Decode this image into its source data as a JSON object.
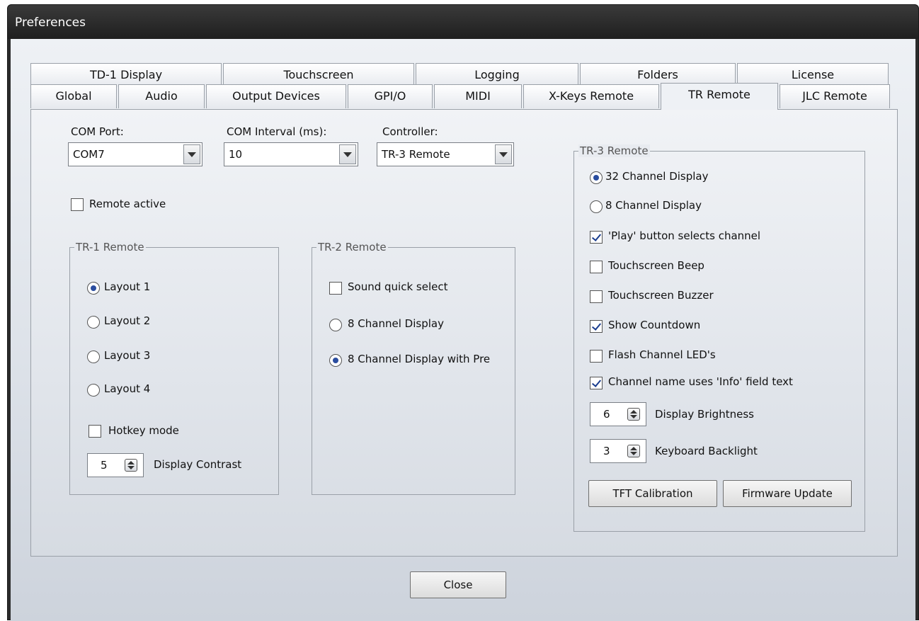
{
  "window": {
    "title": "Preferences"
  },
  "tabs": {
    "row1": [
      "TD-1 Display",
      "Touchscreen",
      "Logging",
      "Folders",
      "License"
    ],
    "row2": [
      "Global",
      "Audio",
      "Output Devices",
      "GPI/O",
      "MIDI",
      "X-Keys Remote",
      "TR Remote",
      "JLC Remote"
    ],
    "active": "TR Remote"
  },
  "com_port": {
    "label": "COM Port:",
    "value": "COM7"
  },
  "com_interval": {
    "label": "COM Interval (ms):",
    "value": "10"
  },
  "controller": {
    "label": "Controller:",
    "value": "TR-3 Remote"
  },
  "remote_active": {
    "label": "Remote active",
    "checked": false
  },
  "tr1": {
    "title": "TR-1 Remote",
    "layouts": [
      "Layout 1",
      "Layout 2",
      "Layout 3",
      "Layout 4"
    ],
    "selected_layout": "Layout 1",
    "hotkey_label": "Hotkey mode",
    "hotkey_checked": false,
    "contrast_value": "5",
    "contrast_label": "Display Contrast"
  },
  "tr2": {
    "title": "TR-2 Remote",
    "sound_quick_select": "Sound quick select",
    "sound_quick_select_checked": false,
    "option_8ch": "8 Channel Display",
    "option_8ch_pre": "8 Channel Display with Pre",
    "selected": "8 Channel Display with Pre"
  },
  "tr3": {
    "title": "TR-3 Remote",
    "radio_32": "32 Channel Display",
    "radio_8": "8 Channel Display",
    "selected": "32 Channel Display",
    "checks": [
      {
        "label": "'Play' button selects channel",
        "checked": true
      },
      {
        "label": "Touchscreen Beep",
        "checked": false
      },
      {
        "label": "Touchscreen Buzzer",
        "checked": false
      },
      {
        "label": "Show Countdown",
        "checked": true
      },
      {
        "label": "Flash Channel LED's",
        "checked": false
      },
      {
        "label": "Channel name uses 'Info' field text",
        "checked": true
      }
    ],
    "brightness_value": "6",
    "brightness_label": "Display Brightness",
    "backlight_value": "3",
    "backlight_label": "Keyboard Backlight",
    "tft_button": "TFT Calibration",
    "firmware_button": "Firmware Update"
  },
  "close_button": "Close",
  "colors": {
    "titlebar": "#2b2b2b",
    "radio_dot": "#2a4d9f",
    "check_mark": "#1a3d8f"
  }
}
